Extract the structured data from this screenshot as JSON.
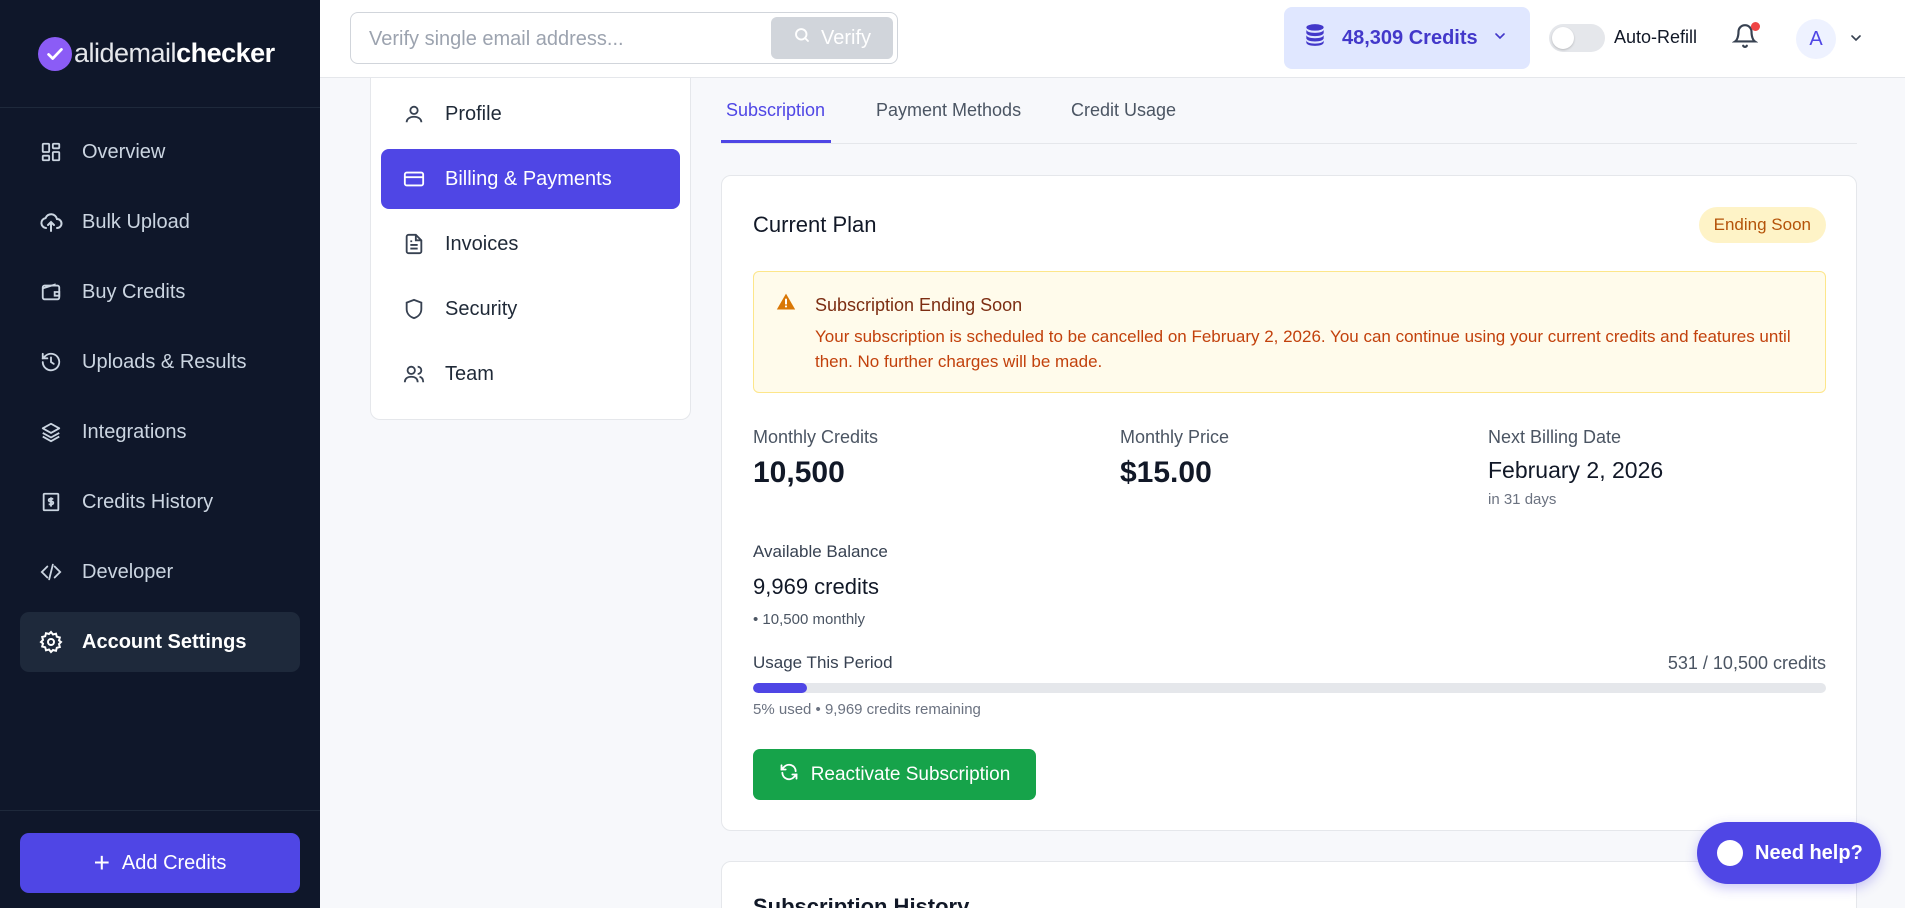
{
  "brand": {
    "logo_bold": "alidemail",
    "logo_end": "checker",
    "accent": "#4f46e5"
  },
  "sidebar": {
    "items": [
      {
        "label": "Overview",
        "icon": "grid-icon"
      },
      {
        "label": "Bulk Upload",
        "icon": "cloud-upload-icon"
      },
      {
        "label": "Buy Credits",
        "icon": "wallet-icon"
      },
      {
        "label": "Uploads & Results",
        "icon": "history-icon"
      },
      {
        "label": "Integrations",
        "icon": "layers-icon"
      },
      {
        "label": "Credits History",
        "icon": "receipt-dollar-icon"
      },
      {
        "label": "Developer",
        "icon": "code-icon"
      },
      {
        "label": "Account Settings",
        "icon": "gear-icon",
        "active": true
      }
    ],
    "add_credits": "Add Credits"
  },
  "topbar": {
    "search_placeholder": "Verify single email address...",
    "verify_label": "Verify",
    "credits": "48,309 Credits",
    "autorefill_label": "Auto-Refill",
    "avatar_initial": "A"
  },
  "settings_menu": {
    "items": [
      {
        "label": "Profile",
        "icon": "user-icon"
      },
      {
        "label": "Billing & Payments",
        "icon": "credit-card-icon",
        "active": true
      },
      {
        "label": "Invoices",
        "icon": "document-icon"
      },
      {
        "label": "Security",
        "icon": "shield-icon"
      },
      {
        "label": "Team",
        "icon": "users-icon"
      }
    ]
  },
  "tabs": [
    {
      "label": "Subscription",
      "active": true
    },
    {
      "label": "Payment Methods"
    },
    {
      "label": "Credit Usage"
    }
  ],
  "plan": {
    "title": "Current Plan",
    "badge": "Ending Soon",
    "alert_title": "Subscription Ending Soon",
    "alert_body": "Your subscription is scheduled to be cancelled on February 2, 2026. You can continue using your current credits and features until then. No further charges will be made.",
    "monthly_credits_label": "Monthly Credits",
    "monthly_credits": "10,500",
    "monthly_price_label": "Monthly Price",
    "monthly_price": "$15.00",
    "next_billing_label": "Next Billing Date",
    "next_billing": "February 2, 2026",
    "next_billing_sub": "in 31 days",
    "available_label": "Available Balance",
    "available": "9,969 credits",
    "available_sub": "• 10,500 monthly",
    "usage_label": "Usage This Period",
    "usage_count": "531 / 10,500 credits",
    "usage_fraction": 0.05,
    "usage_sub": "5% used • 9,969 credits remaining",
    "reactivate": "Reactivate Subscription"
  },
  "history": {
    "title": "Subscription History"
  },
  "help": {
    "label": "Need help?"
  }
}
